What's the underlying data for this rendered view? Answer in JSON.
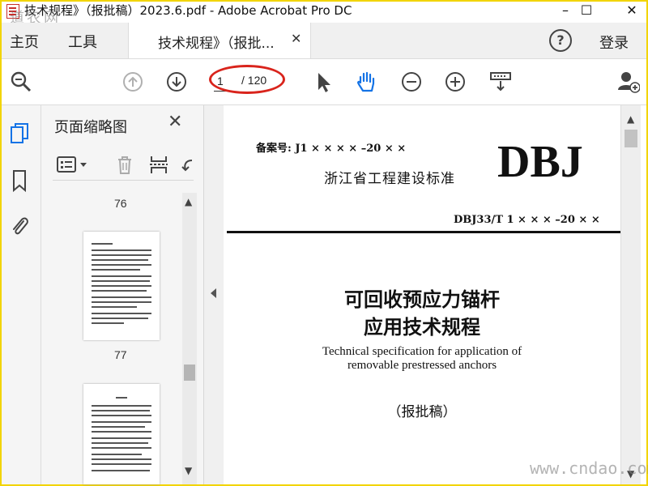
{
  "window": {
    "title": "技术规程》（报批稿）2023.6.pdf - Adobe Acrobat Pro DC",
    "minimize": "–",
    "maximize": "☐",
    "close": "✕"
  },
  "watermark": {
    "top_left": "道农网",
    "bottom_right": "www.cndao.com"
  },
  "menu": {
    "home": "主页",
    "tools": "工具",
    "tab_label": "技术规程》（报批...",
    "tab_close": "✕",
    "help": "?",
    "login": "登录"
  },
  "toolbar": {
    "page_current": "1",
    "page_total": "/ 120",
    "icons": [
      "search-zoom-icon",
      "page-up-icon",
      "page-down-icon",
      "select-arrow-icon",
      "hand-icon",
      "zoom-out-icon",
      "zoom-in-icon",
      "scroll-mode-icon",
      "add-user-icon"
    ],
    "highlight_color": "#d9241c",
    "accent_color": "#1473e6"
  },
  "sidebar": {
    "rail_icons": [
      "page-thumbnails-icon",
      "bookmarks-icon",
      "attachments-icon"
    ],
    "panel_title": "页面缩略图",
    "panel_close": "✕",
    "thumbnails": [
      {
        "page": "76"
      },
      {
        "page": "77"
      }
    ]
  },
  "document": {
    "record_number": "备案号: J1 × × × × –20 × ×",
    "series_logo": "DBJ",
    "standard_type": "浙江省工程建设标准",
    "code": "DBJ33/T 1 × × × –20 × ×",
    "title_line1": "可回收预应力锚杆",
    "title_line2": "应用技术规程",
    "english_line1": "Technical specification for application of",
    "english_line2": "removable prestressed anchors",
    "draft_label": "（报批稿）"
  }
}
